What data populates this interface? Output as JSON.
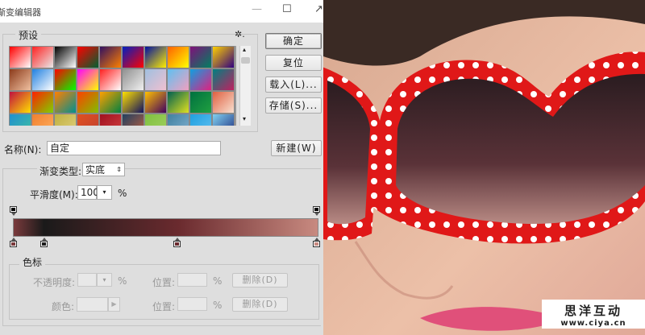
{
  "dialog": {
    "title": "渐变编辑器",
    "presets": {
      "label": "预设",
      "gear_icon": "gear-icon",
      "swatches": [
        [
          "#ff0000",
          "#ffffff"
        ],
        [
          "#ff2222",
          "#e8e8e8"
        ],
        [
          "#000000",
          "#ffffff"
        ],
        [
          "#ff0000",
          "#006030"
        ],
        [
          "#301060",
          "#ff8000"
        ],
        [
          "#0020c0",
          "#ff0000"
        ],
        [
          "#0010a0",
          "#ffee00"
        ],
        [
          "#ff6000",
          "#ffff00"
        ],
        [
          "#80107a",
          "#008060"
        ],
        [
          "#ffd000",
          "#300080"
        ],
        [
          "#8b3a1a",
          "#f0c0a0"
        ],
        [
          "#2080e0",
          "#ffffff"
        ],
        [
          "#ff0000",
          "#00ff00"
        ],
        [
          "#ff00ff",
          "#ffff00"
        ],
        [
          "#ff2020",
          "#ffffff"
        ],
        [
          "#909090",
          "#f0f0f0"
        ],
        [
          "#a0c0e0",
          "#f0c0d0"
        ],
        [
          "#60c0f0",
          "#f0a0c0"
        ],
        [
          "#10a0e0",
          "#e02080"
        ],
        [
          "#008080",
          "#c02060"
        ],
        [
          "#c01040",
          "#ffe000"
        ],
        [
          "#ff2000",
          "#80d000"
        ],
        [
          "#ff8000",
          "#009090"
        ],
        [
          "#ff4000",
          "#80c000"
        ],
        [
          "#ffa000",
          "#008040"
        ],
        [
          "#ffe000",
          "#101060"
        ],
        [
          "#ffc000",
          "#400060"
        ],
        [
          "#006050",
          "#e0e020"
        ],
        [
          "#007040",
          "#20a040"
        ],
        [
          "#e06040",
          "#f8e0d0"
        ],
        [
          "#2090d0",
          "#40c0a0"
        ],
        [
          "#f08030",
          "#ffb060"
        ],
        [
          "#c0b040",
          "#e0d080"
        ],
        [
          "#e05020",
          "#c04030"
        ],
        [
          "#a01020",
          "#d04040"
        ],
        [
          "#204060",
          "#c06040"
        ],
        [
          "#80c040",
          "#a0d060"
        ],
        [
          "#4080a0",
          "#80b0d0"
        ],
        [
          "#20a0e0",
          "#60c0f0"
        ],
        [
          "#80d0f0",
          "#203080"
        ]
      ]
    },
    "buttons": {
      "ok": "确定",
      "reset": "复位",
      "load": "载入(L)...",
      "save": "存储(S)...",
      "new": "新建(W)"
    },
    "name": {
      "label": "名称(N):",
      "value": "自定"
    },
    "gradient_type": {
      "label": "渐变类型:",
      "value": "实底"
    },
    "smoothness": {
      "label": "平滑度(M):",
      "value": "100",
      "unit": "%"
    },
    "gradient": {
      "colors": [
        "#7a3a3c",
        "#2a1a1e",
        "#4a2024",
        "#6a2a2e",
        "#c88a80"
      ],
      "color_stops": [
        {
          "color": "#7a3a3c",
          "position": 0
        },
        {
          "color": "#1a1a1a",
          "position": 10
        },
        {
          "color": "#6a2a2e",
          "position": 54
        },
        {
          "color": "#c88a80",
          "position": 100
        }
      ],
      "opacity_stops": [
        {
          "position": 0
        },
        {
          "position": 100
        }
      ]
    },
    "stops_group": {
      "label": "色标",
      "opacity_label": "不透明度:",
      "opacity_unit": "%",
      "location_label": "位置:",
      "location_unit": "%",
      "delete_label": "删除(D)",
      "color_label": "颜色:"
    }
  },
  "watermark": {
    "line1": "思洋互动",
    "line2": "www.ciya.cn"
  },
  "colors": {
    "frame_red": "#e01818",
    "lens": "#3a2428",
    "skin": "#e8b8a0"
  }
}
